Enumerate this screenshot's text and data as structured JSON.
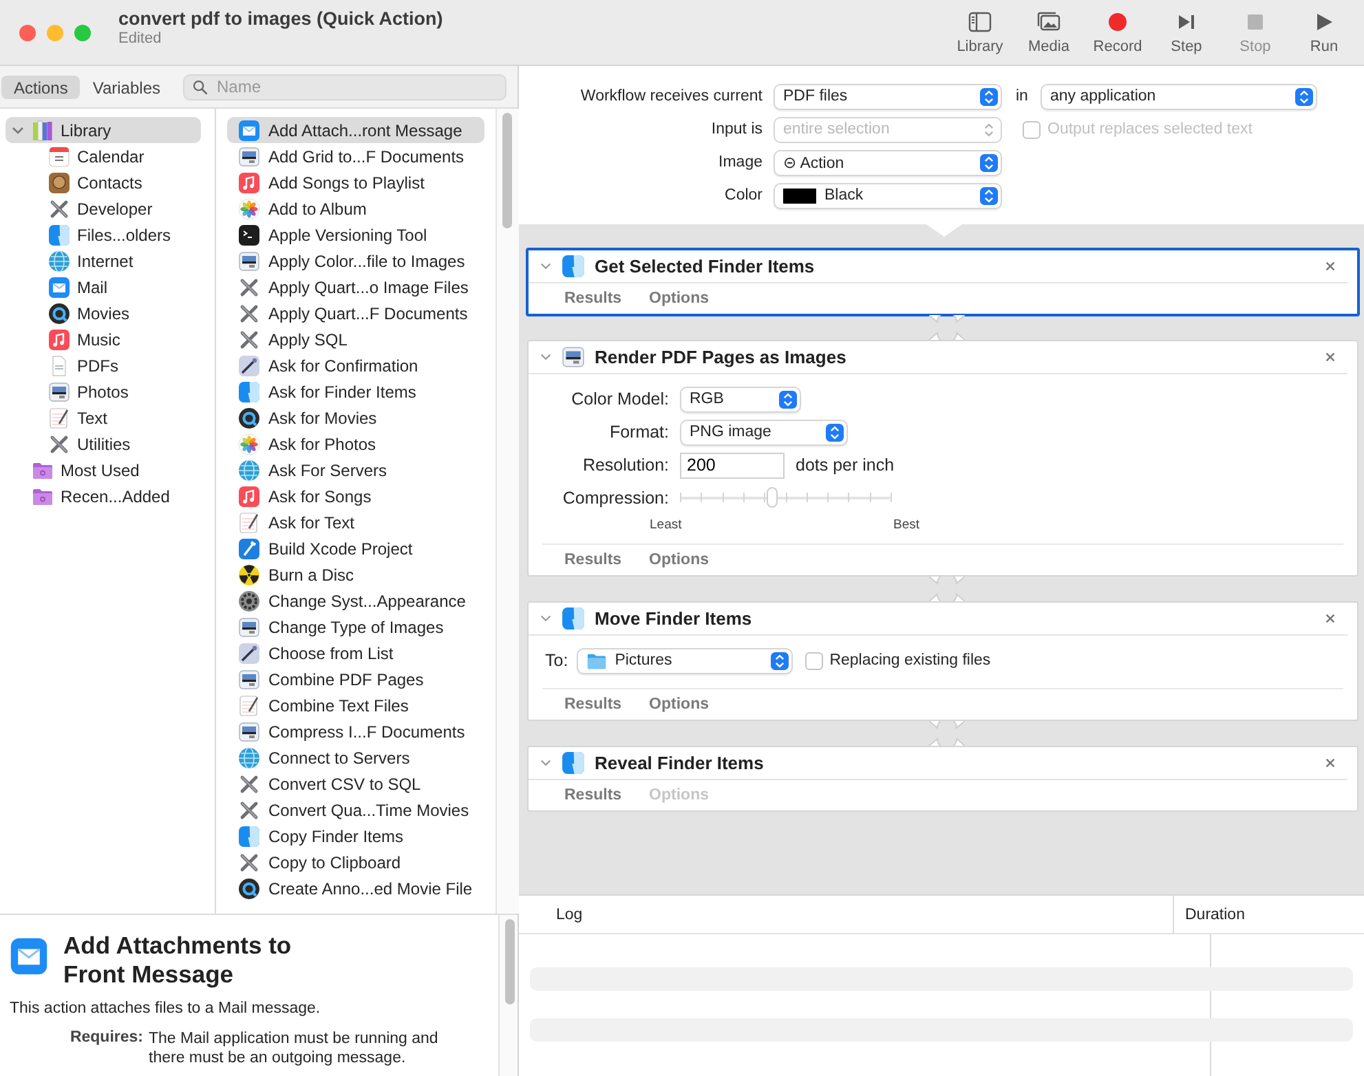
{
  "window": {
    "title": "convert pdf to images (Quick Action)",
    "subtitle": "Edited"
  },
  "toolbar": [
    {
      "label": "Library",
      "kind": "library",
      "disabled": false
    },
    {
      "label": "Media",
      "kind": "media",
      "disabled": false
    },
    {
      "label": "Record",
      "kind": "record",
      "disabled": false
    },
    {
      "label": "Step",
      "kind": "step",
      "disabled": false
    },
    {
      "label": "Stop",
      "kind": "stop",
      "disabled": true
    },
    {
      "label": "Run",
      "kind": "run",
      "disabled": false
    }
  ],
  "library_tabs": [
    {
      "label": "Actions",
      "selected": true
    },
    {
      "label": "Variables",
      "selected": false
    }
  ],
  "search": {
    "placeholder": "Name"
  },
  "library_tree": [
    {
      "label": "Library",
      "kind": "library",
      "selected": true,
      "expanded": true,
      "children": [
        {
          "label": "Calendar",
          "kind": "calendar",
          "selected": false
        },
        {
          "label": "Contacts",
          "kind": "contacts",
          "selected": false
        },
        {
          "label": "Developer",
          "kind": "tools",
          "selected": false
        },
        {
          "label": "Files...olders",
          "kind": "finder",
          "selected": false
        },
        {
          "label": "Internet",
          "kind": "globe",
          "selected": false
        },
        {
          "label": "Mail",
          "kind": "mail",
          "selected": false
        },
        {
          "label": "Movies",
          "kind": "quicktime",
          "selected": false
        },
        {
          "label": "Music",
          "kind": "music",
          "selected": false
        },
        {
          "label": "PDFs",
          "kind": "pdf",
          "selected": false
        },
        {
          "label": "Photos",
          "kind": "preview",
          "selected": false
        },
        {
          "label": "Text",
          "kind": "textedit",
          "selected": false
        },
        {
          "label": "Utilities",
          "kind": "tools",
          "selected": false
        }
      ]
    },
    {
      "label": "Most Used",
      "kind": "folder",
      "selected": false
    },
    {
      "label": "Recen...Added",
      "kind": "folder",
      "selected": false
    }
  ],
  "actions": [
    {
      "label": "Add Attach...ront Message",
      "kind": "mail",
      "selected": true
    },
    {
      "label": "Add Grid to...F Documents",
      "kind": "preview",
      "selected": false
    },
    {
      "label": "Add Songs to Playlist",
      "kind": "music",
      "selected": false
    },
    {
      "label": "Add to Album",
      "kind": "photos",
      "selected": false
    },
    {
      "label": "Apple Versioning Tool",
      "kind": "terminal",
      "selected": false
    },
    {
      "label": "Apply Color...file to Images",
      "kind": "preview",
      "selected": false
    },
    {
      "label": "Apply Quart...o Image Files",
      "kind": "tools",
      "selected": false
    },
    {
      "label": "Apply Quart...F Documents",
      "kind": "tools",
      "selected": false
    },
    {
      "label": "Apply SQL",
      "kind": "tools",
      "selected": false
    },
    {
      "label": "Ask for Confirmation",
      "kind": "automator",
      "selected": false
    },
    {
      "label": "Ask for Finder Items",
      "kind": "finder",
      "selected": false
    },
    {
      "label": "Ask for Movies",
      "kind": "quicktime",
      "selected": false
    },
    {
      "label": "Ask for Photos",
      "kind": "photos",
      "selected": false
    },
    {
      "label": "Ask For Servers",
      "kind": "globe",
      "selected": false
    },
    {
      "label": "Ask for Songs",
      "kind": "music",
      "selected": false
    },
    {
      "label": "Ask for Text",
      "kind": "textedit",
      "selected": false
    },
    {
      "label": "Build Xcode Project",
      "kind": "xcode",
      "selected": false
    },
    {
      "label": "Burn a Disc",
      "kind": "burn",
      "selected": false
    },
    {
      "label": "Change Syst...Appearance",
      "kind": "gear",
      "selected": false
    },
    {
      "label": "Change Type of Images",
      "kind": "preview",
      "selected": false
    },
    {
      "label": "Choose from List",
      "kind": "automator",
      "selected": false
    },
    {
      "label": "Combine PDF Pages",
      "kind": "preview",
      "selected": false
    },
    {
      "label": "Combine Text Files",
      "kind": "textedit",
      "selected": false
    },
    {
      "label": "Compress I...F Documents",
      "kind": "preview",
      "selected": false
    },
    {
      "label": "Connect to Servers",
      "kind": "globe",
      "selected": false
    },
    {
      "label": "Convert CSV to SQL",
      "kind": "tools",
      "selected": false
    },
    {
      "label": "Convert Qua...Time Movies",
      "kind": "tools",
      "selected": false
    },
    {
      "label": "Copy Finder Items",
      "kind": "finder",
      "selected": false
    },
    {
      "label": "Copy to Clipboard",
      "kind": "tools",
      "selected": false
    },
    {
      "label": "Create Anno...ed Movie File",
      "kind": "quicktime",
      "selected": false
    }
  ],
  "description": {
    "kind": "mail",
    "title": "Add Attachments to Front Message",
    "text": "This action attaches files to a Mail message.",
    "details": [
      {
        "label": "Requires:",
        "value": "The Mail application must be running and there must be an outgoing message."
      }
    ]
  },
  "workflow_settings": [
    {
      "kind": "popup_pair",
      "label": "Workflow receives current",
      "value": "PDF files",
      "joiner": "in",
      "value2": "any application",
      "disabled": false
    },
    {
      "kind": "popup_check",
      "label": "Input is",
      "value": "entire selection",
      "disabled": true,
      "checkbox": {
        "label": "Output replaces selected text",
        "checked": false,
        "disabled": true
      }
    },
    {
      "kind": "popup",
      "label": "Image",
      "value": "⊝ Action",
      "disabled": false
    },
    {
      "kind": "color",
      "label": "Color",
      "value": "Black",
      "color": "#000000",
      "disabled": false
    }
  ],
  "cards": [
    {
      "title": "Get Selected Finder Items",
      "kind": "finder",
      "selected": true,
      "expanded": true,
      "footer": [
        {
          "label": "Results",
          "disabled": false
        },
        {
          "label": "Options",
          "disabled": false
        }
      ]
    },
    {
      "title": "Render PDF Pages as Images",
      "kind": "preview",
      "selected": false,
      "expanded": true,
      "fields": [
        {
          "kind": "popup",
          "label": "Color Model:",
          "value": "RGB"
        },
        {
          "kind": "popup",
          "label": "Format:",
          "value": "PNG image"
        },
        {
          "kind": "number",
          "label": "Resolution:",
          "value": "200",
          "unit": "dots per inch"
        },
        {
          "kind": "slider",
          "label": "Compression:",
          "level": 0.44,
          "min_label": "Least",
          "max_label": "Best"
        }
      ],
      "footer": [
        {
          "label": "Results",
          "disabled": false
        },
        {
          "label": "Options",
          "disabled": false
        }
      ]
    },
    {
      "title": "Move Finder Items",
      "kind": "finder",
      "selected": false,
      "expanded": true,
      "fields": [
        {
          "kind": "destination",
          "label": "To:",
          "value": "Pictures",
          "checkbox": {
            "label": "Replacing existing files",
            "checked": false
          }
        }
      ],
      "footer": [
        {
          "label": "Results",
          "disabled": false
        },
        {
          "label": "Options",
          "disabled": false
        }
      ]
    },
    {
      "title": "Reveal Finder Items",
      "kind": "finder",
      "selected": false,
      "expanded": true,
      "footer": [
        {
          "label": "Results",
          "disabled": false
        },
        {
          "label": "Options",
          "disabled": true
        }
      ]
    }
  ],
  "log": {
    "columns": [
      "Log",
      "Duration"
    ]
  }
}
